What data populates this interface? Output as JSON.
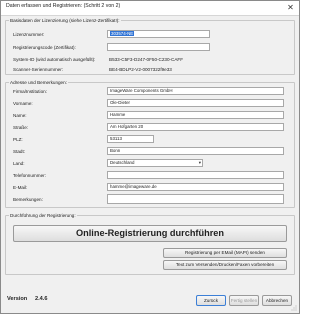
{
  "window": {
    "title": "Daten erfassen und Registrieren: (Schritt 2 von 2)",
    "close_glyph": "✕"
  },
  "license": {
    "legend": "Basisdaten der Lizenzierung (siehe Lizenz-Zertifikat!):",
    "license_number_label": "Lizenznummer:",
    "license_number_value": "303574-NE",
    "registration_code_label": "Registrierungscode (Zertifikat):",
    "registration_code_value": "",
    "system_id_label": "System-ID (wird automatisch ausgefüllt):",
    "system_id_value": "B533-C5F3-D247-0F50-C230-CAFF",
    "scanner_serial_label": "Scanner-Seriennummer:",
    "scanner_serial_value": "BE4-BDLP2-V2-0007322f9e33"
  },
  "address": {
    "legend": "Adresse und Bemerkungen:",
    "fields": [
      {
        "label": "Firma/Institution:",
        "value": "ImageWare Components GmbH"
      },
      {
        "label": "Vorname:",
        "value": "Ole-Dieter"
      },
      {
        "label": "Name:",
        "value": "Hamme"
      },
      {
        "label": "Straße:",
        "value": "Am Hofgarten 20"
      },
      {
        "label": "PLZ:",
        "value": "53113"
      },
      {
        "label": "Stadt:",
        "value": "Bonn"
      }
    ],
    "country_label": "Land:",
    "country_value": "Deutschland",
    "phone_label": "Telefonnummer:",
    "phone_value": "",
    "email_label": "E-Mail:",
    "email_value": "hamme@imageware.de",
    "remarks_label": "Bemerkungen:",
    "remarks_value": ""
  },
  "registration": {
    "legend": "Durchführung der Registrierung:",
    "online_button": "Online-Registrierung durchführen",
    "email_button": "Registrierung per EMail (MAPI) senden",
    "text_button": "Text zum Versenden/Drucken/Faxen vorbereiten"
  },
  "footer": {
    "version_label": "Version",
    "version_value": "2.4.6",
    "back_button": "Zurück",
    "finish_button": "Fertig stellen",
    "cancel_button": "Abbrechen"
  }
}
